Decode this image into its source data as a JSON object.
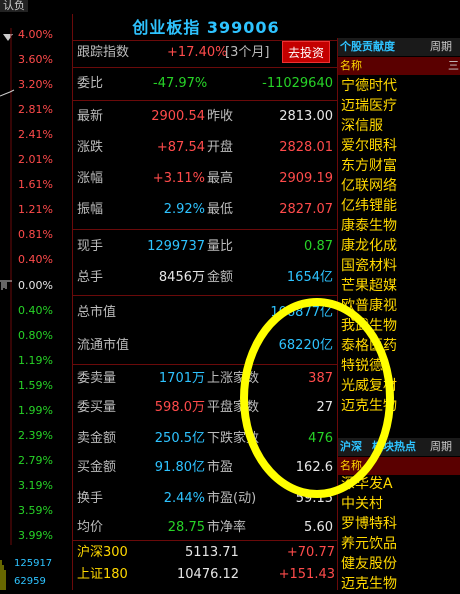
{
  "window_title": "认负",
  "title": "创业板指 399006",
  "axis": {
    "labels": [
      "4.00%",
      "3.60%",
      "3.20%",
      "2.81%",
      "2.41%",
      "2.01%",
      "1.61%",
      "1.21%",
      "0.81%",
      "0.40%",
      "0.00%",
      "0.40%",
      "0.80%",
      "1.19%",
      "1.59%",
      "1.99%",
      "2.39%",
      "2.79%",
      "3.19%",
      "3.59%",
      "3.99%"
    ],
    "vol_top": "125917",
    "vol_bottom": "62959"
  },
  "header": {
    "label": "跟踪指数",
    "value": "+17.40%",
    "period": "[3个月]",
    "button": "去投资"
  },
  "weibi": {
    "label": "委比",
    "pct": "-47.97%",
    "diff": "-11029640"
  },
  "quote": [
    {
      "l1": "最新",
      "v1": "2900.54",
      "l2": "昨收",
      "v2": "2813.00"
    },
    {
      "l1": "涨跌",
      "v1": "+87.54",
      "l2": "开盘",
      "v2": "2828.01"
    },
    {
      "l1": "涨幅",
      "v1": "+3.11%",
      "l2": "最高",
      "v2": "2909.19"
    },
    {
      "l1": "振幅",
      "v1": "2.92%",
      "l2": "最低",
      "v2": "2827.07"
    }
  ],
  "vol": [
    {
      "l1": "现手",
      "v1": "1299737",
      "l2": "量比",
      "v2": "0.87"
    },
    {
      "l1": "总手",
      "v1": "8456万",
      "l2": "金额",
      "v2": "1654亿"
    }
  ],
  "cap": [
    {
      "l": "总市值",
      "v": "106877亿"
    },
    {
      "l": "流通市值",
      "v": "68220亿"
    }
  ],
  "stats": [
    {
      "l1": "委卖量",
      "v1": "1701万",
      "l2": "上涨家数",
      "v2": "387"
    },
    {
      "l1": "委买量",
      "v1": "598.0万",
      "l2": "平盘家数",
      "v2": "27"
    },
    {
      "l1": "卖金额",
      "v1": "250.5亿",
      "l2": "下跌家数",
      "v2": "476"
    },
    {
      "l1": "买金额",
      "v1": "91.80亿",
      "l2": "市盈",
      "v2": "162.6"
    },
    {
      "l1": "换手",
      "v1": "2.44%",
      "l2": "市盈(动)",
      "v2": "59.15"
    },
    {
      "l1": "均价",
      "v1": "28.75",
      "l2": "市净率",
      "v2": "5.60"
    }
  ],
  "indices": [
    {
      "name": "沪深300",
      "value": "5113.71",
      "change": "+70.77"
    },
    {
      "name": "上证180",
      "value": "10476.12",
      "change": "+151.43"
    }
  ],
  "right_panel": {
    "tab1": "个股贡献度",
    "tab2": "周期",
    "col": "名称",
    "col2": "三",
    "stocks": [
      "宁德时代",
      "迈瑞医疗",
      "深信服",
      "爱尔眼科",
      "东方财富",
      "亿联网络",
      "亿纬锂能",
      "康泰生物",
      "康龙化成",
      "国瓷材料",
      "芒果超媒",
      "欧普康视",
      "我武生物",
      "泰格医药",
      "特锐德",
      "光威复材",
      "迈克生物"
    ],
    "tab3": "沪深",
    "tab3b": "板块热点",
    "tab4": "周期",
    "col_b": "名称",
    "hot": [
      "深华发A",
      "中关村",
      "罗博特科",
      "养元饮品",
      "健友股份",
      "迈克生物"
    ]
  }
}
